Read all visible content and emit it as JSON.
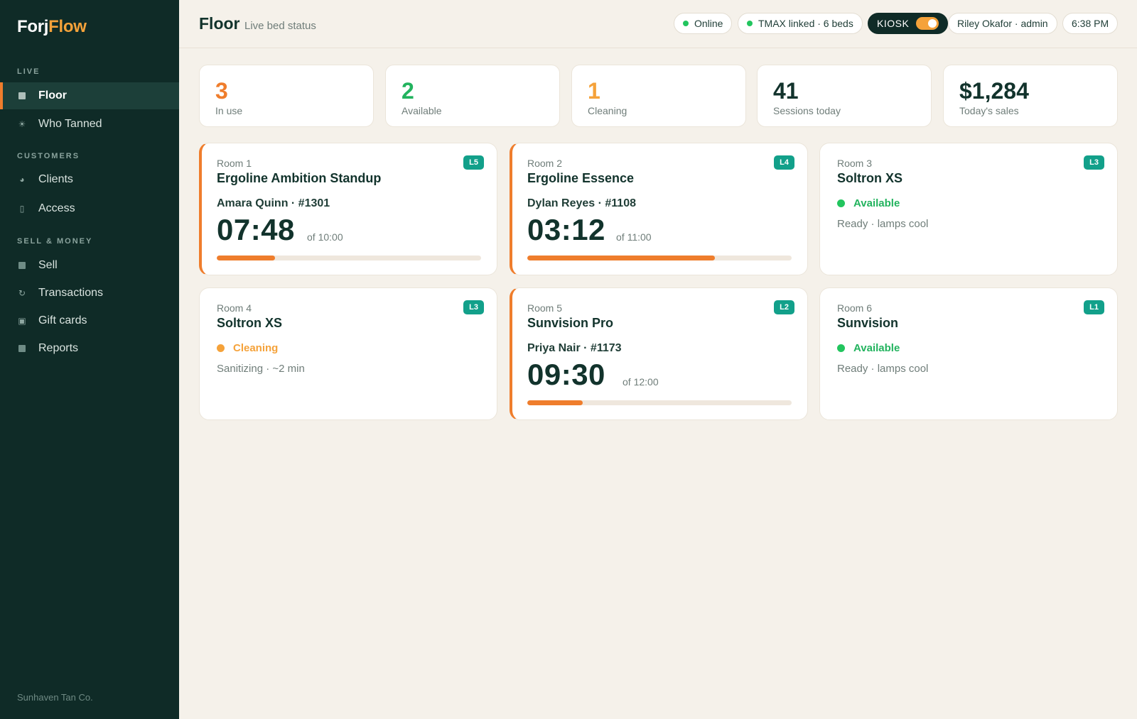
{
  "app": {
    "logo_part1": "Forj",
    "logo_part2": "Flow",
    "footer": "Sunhaven Tan Co."
  },
  "sidebar": {
    "sections": [
      {
        "title": "LIVE",
        "items": [
          {
            "label": "Floor",
            "icon": "grid-icon",
            "active": true
          },
          {
            "label": "Who Tanned",
            "icon": "sun-icon"
          }
        ]
      },
      {
        "title": "CUSTOMERS",
        "items": [
          {
            "label": "Clients",
            "icon": "person-icon"
          },
          {
            "label": "Access",
            "icon": "id-card-icon"
          }
        ]
      },
      {
        "title": "SELL & MONEY",
        "items": [
          {
            "label": "Sell",
            "icon": "register-icon"
          },
          {
            "label": "Transactions",
            "icon": "refresh-icon"
          },
          {
            "label": "Gift cards",
            "icon": "gift-card-icon"
          },
          {
            "label": "Reports",
            "icon": "report-icon"
          }
        ]
      }
    ]
  },
  "header": {
    "title": "Floor",
    "subtitle": "Live bed status",
    "online": "Online",
    "tmax": "TMAX linked · 6 beds",
    "kiosk": "KIOSK",
    "kiosk_on": true,
    "user": "Riley Okafor · admin",
    "time": "6:38 PM"
  },
  "stats": [
    {
      "value": "3",
      "label": "In use",
      "color": "#ef7d2c"
    },
    {
      "value": "2",
      "label": "Available",
      "color": "#22b35e"
    },
    {
      "value": "1",
      "label": "Cleaning",
      "color": "#f5a23a"
    },
    {
      "value": "41",
      "label": "Sessions today",
      "color": "#12332c"
    },
    {
      "value": "$1,284",
      "label": "Today's sales",
      "color": "#12332c"
    }
  ],
  "rooms": [
    {
      "name": "Room 1",
      "model": "Ergoline Ambition Standup",
      "level": "L5",
      "state": "in_use",
      "client": "Amara Quinn · #1301",
      "timer": "07:48",
      "total": "of 10:00",
      "progress": 0.22
    },
    {
      "name": "Room 2",
      "model": "Ergoline Essence",
      "level": "L4",
      "state": "in_use",
      "client": "Dylan Reyes · #1108",
      "timer": "03:12",
      "total": "of 11:00",
      "progress": 0.71
    },
    {
      "name": "Room 3",
      "model": "Soltron XS",
      "level": "L3",
      "state": "available",
      "status": "Available",
      "note": "Ready · lamps cool"
    },
    {
      "name": "Room 4",
      "model": "Soltron XS",
      "level": "L3",
      "state": "cleaning",
      "status": "Cleaning",
      "note": "Sanitizing · ~2 min"
    },
    {
      "name": "Room 5",
      "model": "Sunvision Pro",
      "level": "L2",
      "state": "in_use",
      "client": "Priya Nair · #1173",
      "timer": "09:30",
      "total": "of 12:00",
      "progress": 0.21
    },
    {
      "name": "Room 6",
      "model": "Sunvision",
      "level": "L1",
      "state": "available",
      "status": "Available",
      "note": "Ready · lamps cool"
    }
  ],
  "colors": {
    "available": "#22b35e",
    "cleaning": "#f5a23a",
    "in_use": "#ef7d2c",
    "badge": "#12a08a"
  }
}
